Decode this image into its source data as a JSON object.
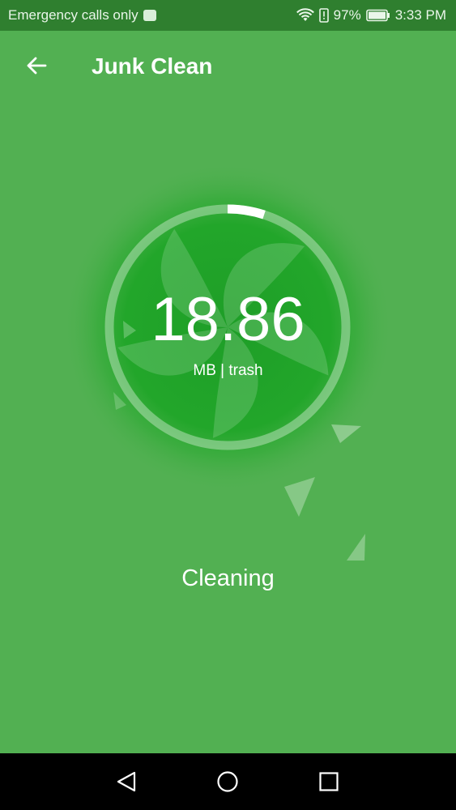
{
  "status_bar": {
    "carrier_text": "Emergency calls only",
    "battery_percent": "97%",
    "time": "3:33 PM"
  },
  "app_bar": {
    "title": "Junk Clean",
    "back_icon": "arrow-left-icon"
  },
  "scan": {
    "value": "18.86",
    "unit_label": "MB | trash",
    "status_text": "Cleaning",
    "progress_fraction": 0.05
  },
  "nav_bar": {
    "back_icon": "triangle-back-icon",
    "home_icon": "circle-home-icon",
    "recents_icon": "square-recents-icon"
  },
  "colors": {
    "background": "#52b052",
    "status_bar": "#2f7f2f",
    "glow": "#22a62a",
    "text": "#ffffff"
  }
}
